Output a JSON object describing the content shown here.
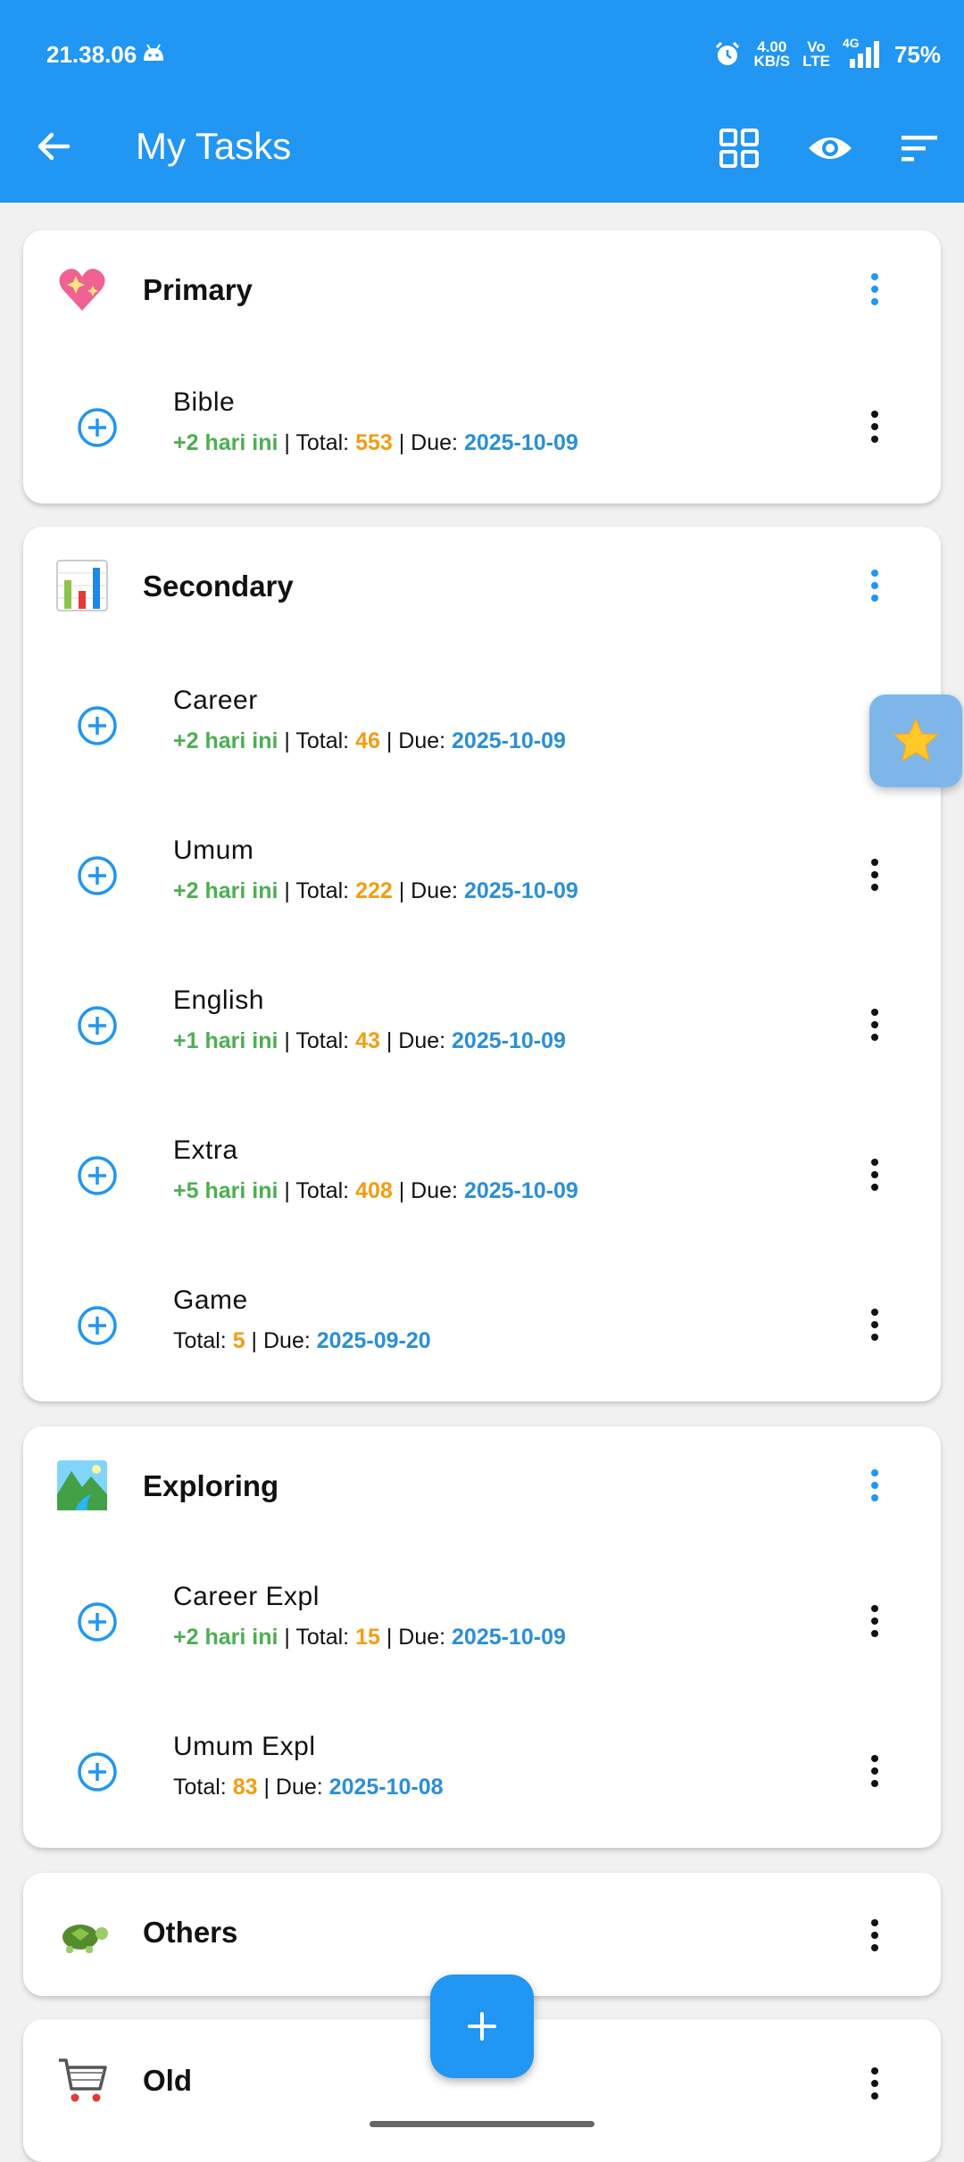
{
  "status": {
    "time": "21.38.06",
    "speed_top": "4.00",
    "speed_bottom": "KB/S",
    "volte_top": "Vo",
    "volte_bottom": "LTE",
    "net": "4G",
    "battery": "75%"
  },
  "header": {
    "title": "My Tasks"
  },
  "labels": {
    "total": "Total: ",
    "due": "Due: ",
    "sep": " | "
  },
  "categories": [
    {
      "name": "Primary",
      "icon": "sparkling-heart-icon",
      "tasks": [
        {
          "name": "Bible",
          "today": "+2 hari ini",
          "total": "553",
          "due": "2025-10-09"
        }
      ]
    },
    {
      "name": "Secondary",
      "icon": "bar-chart-icon",
      "tasks": [
        {
          "name": "Career",
          "today": "+2 hari ini",
          "total": "46",
          "due": "2025-10-09"
        },
        {
          "name": "Umum",
          "today": "+2 hari ini",
          "total": "222",
          "due": "2025-10-09"
        },
        {
          "name": "English",
          "today": "+1 hari ini",
          "total": "43",
          "due": "2025-10-09"
        },
        {
          "name": "Extra",
          "today": "+5 hari ini",
          "total": "408",
          "due": "2025-10-09"
        },
        {
          "name": "Game",
          "today": "",
          "total": "5",
          "due": "2025-09-20"
        }
      ]
    },
    {
      "name": "Exploring",
      "icon": "landscape-icon",
      "tasks": [
        {
          "name": "Career Expl",
          "today": "+2 hari ini",
          "total": "15",
          "due": "2025-10-09"
        },
        {
          "name": "Umum Expl",
          "today": "",
          "total": "83",
          "due": "2025-10-08"
        }
      ]
    },
    {
      "name": "Others",
      "icon": "turtle-icon",
      "tasks": []
    },
    {
      "name": "Old",
      "icon": "shopping-cart-icon",
      "tasks": []
    }
  ],
  "colors": {
    "primary": "#2196f3",
    "today": "#4caf50",
    "total": "#f39c12",
    "due": "#2a8fd8"
  }
}
